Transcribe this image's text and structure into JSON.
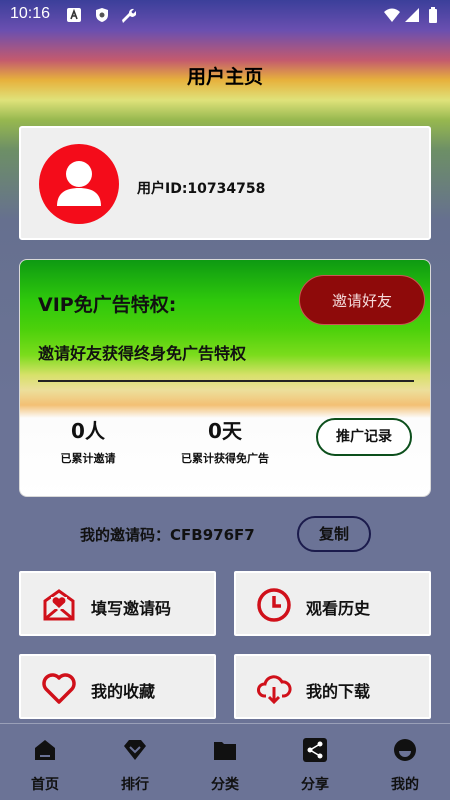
{
  "status_bar": {
    "time": "10:16"
  },
  "header": {
    "title": "用户主页"
  },
  "user": {
    "id_label": "用户ID:10734758"
  },
  "vip": {
    "title": "VIP免广告特权:",
    "invite_button": "邀请好友",
    "description": "邀请好友获得终身免广告特权",
    "stats": [
      {
        "value": "0人",
        "label": "已累计邀请"
      },
      {
        "value": "0天",
        "label": "已累计获得免广告"
      }
    ],
    "records_button": "推广记录"
  },
  "invite_code": {
    "label": "我的邀请码：CFB976F7",
    "copy_button": "复制"
  },
  "menu": [
    {
      "label": "填写邀请码",
      "icon": "envelope-heart-icon"
    },
    {
      "label": "观看历史",
      "icon": "clock-icon"
    },
    {
      "label": "我的收藏",
      "icon": "heart-icon"
    },
    {
      "label": "我的下载",
      "icon": "cloud-download-icon"
    }
  ],
  "bottom_nav": [
    {
      "label": "首页",
      "icon": "home-icon"
    },
    {
      "label": "排行",
      "icon": "ranking-icon"
    },
    {
      "label": "分类",
      "icon": "folder-icon"
    },
    {
      "label": "分享",
      "icon": "share-icon"
    },
    {
      "label": "我的",
      "icon": "profile-icon"
    }
  ],
  "colors": {
    "accent_red": "#d0101a",
    "dark_red": "#8e0a0a",
    "tile_bg": "#efefef"
  }
}
